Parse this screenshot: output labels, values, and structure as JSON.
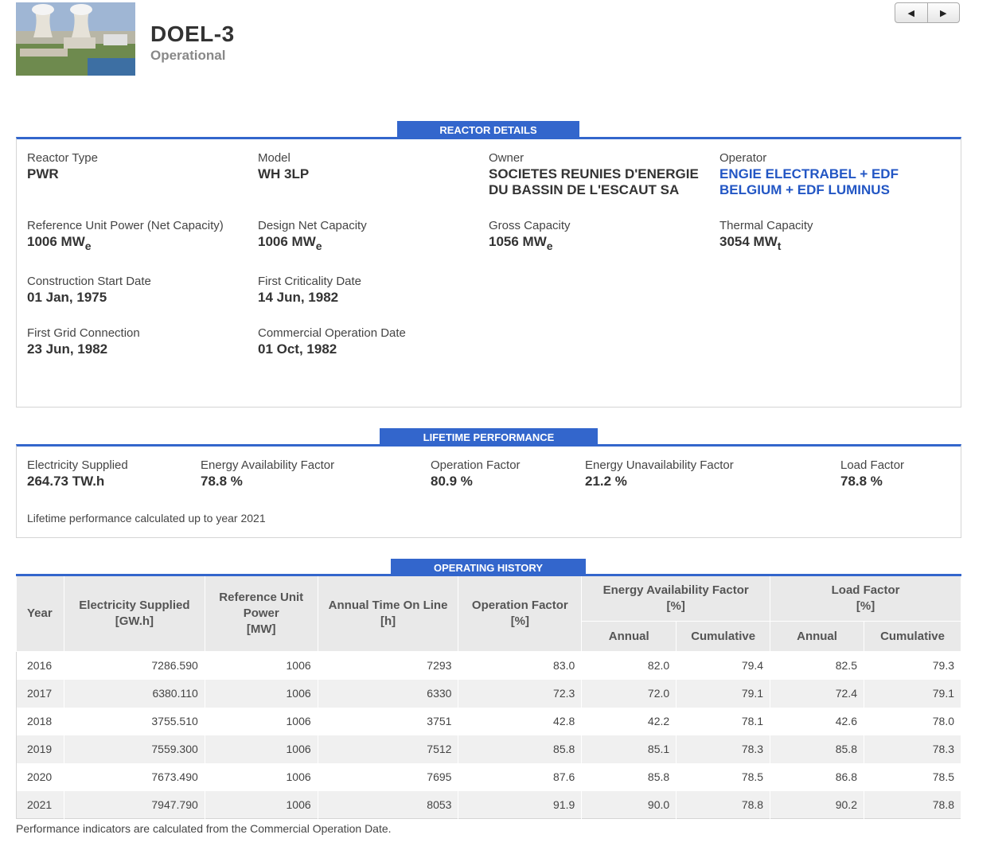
{
  "header": {
    "title": "DOEL-3",
    "status": "Operational",
    "photo_icon": "reactor-photo"
  },
  "pager": {
    "prev_icon": "◀",
    "next_icon": "▶"
  },
  "reactor_details": {
    "title": "REACTOR DETAILS",
    "reactor_type": {
      "label": "Reactor Type",
      "value": "PWR"
    },
    "model": {
      "label": "Model",
      "value": "WH 3LP"
    },
    "owner": {
      "label": "Owner",
      "value_line1": "SOCIETES REUNIES D'ENERGIE",
      "value_line2": "DU BASSIN DE L'ESCAUT SA"
    },
    "operator": {
      "label": "Operator",
      "value_line1": "ENGIE ELECTRABEL + EDF",
      "value_line2": "BELGIUM + EDF LUMINUS"
    },
    "reference_unit_power": {
      "label": "Reference Unit Power (Net Capacity)",
      "value": "1006 MW",
      "sub": "e"
    },
    "design_net_capacity": {
      "label": "Design Net Capacity",
      "value": "1006 MW",
      "sub": "e"
    },
    "gross_capacity": {
      "label": "Gross Capacity",
      "value": "1056 MW",
      "sub": "e"
    },
    "thermal_capacity": {
      "label": "Thermal Capacity",
      "value": "3054 MW",
      "sub": "t"
    },
    "construction_start": {
      "label": "Construction Start Date",
      "value": "01 Jan, 1975"
    },
    "first_criticality": {
      "label": "First Criticality Date",
      "value": "14 Jun, 1982"
    },
    "first_grid": {
      "label": "First Grid Connection",
      "value": "23 Jun, 1982"
    },
    "commercial_operation": {
      "label": "Commercial Operation Date",
      "value": "01 Oct, 1982"
    }
  },
  "lifetime": {
    "title": "LIFETIME PERFORMANCE",
    "electricity": {
      "label": "Electricity Supplied",
      "value": "264.73 TW.h"
    },
    "eaf": {
      "label": "Energy Availability Factor",
      "value": "78.8 %"
    },
    "operation_factor": {
      "label": "Operation Factor",
      "value": "80.9 %"
    },
    "euf": {
      "label": "Energy Unavailability Factor",
      "value": "21.2 %"
    },
    "load_factor": {
      "label": "Load Factor",
      "value": "78.8 %"
    },
    "note": "Lifetime performance calculated up to year 2021"
  },
  "history": {
    "title": "OPERATING HISTORY",
    "headers": {
      "year": "Year",
      "electricity_1": "Electricity Supplied",
      "electricity_2": "[GW.h]",
      "ref_1": "Reference Unit",
      "ref_2": "Power",
      "ref_3": "[MW]",
      "time_1": "Annual Time On Line",
      "time_2": "[h]",
      "op_1": "Operation Factor",
      "op_2": "[%]",
      "eaf_1": "Energy Availability Factor",
      "eaf_2": "[%]",
      "lf_1": "Load Factor",
      "lf_2": "[%]",
      "annual": "Annual",
      "cumulative": "Cumulative"
    },
    "rows": [
      {
        "year": "2016",
        "electricity": "7286.590",
        "ref": "1006",
        "time": "7293",
        "op": "83.0",
        "eaf_a": "82.0",
        "eaf_c": "79.4",
        "lf_a": "82.5",
        "lf_c": "79.3"
      },
      {
        "year": "2017",
        "electricity": "6380.110",
        "ref": "1006",
        "time": "6330",
        "op": "72.3",
        "eaf_a": "72.0",
        "eaf_c": "79.1",
        "lf_a": "72.4",
        "lf_c": "79.1"
      },
      {
        "year": "2018",
        "electricity": "3755.510",
        "ref": "1006",
        "time": "3751",
        "op": "42.8",
        "eaf_a": "42.2",
        "eaf_c": "78.1",
        "lf_a": "42.6",
        "lf_c": "78.0"
      },
      {
        "year": "2019",
        "electricity": "7559.300",
        "ref": "1006",
        "time": "7512",
        "op": "85.8",
        "eaf_a": "85.1",
        "eaf_c": "78.3",
        "lf_a": "85.8",
        "lf_c": "78.3"
      },
      {
        "year": "2020",
        "electricity": "7673.490",
        "ref": "1006",
        "time": "7695",
        "op": "87.6",
        "eaf_a": "85.8",
        "eaf_c": "78.5",
        "lf_a": "86.8",
        "lf_c": "78.5"
      },
      {
        "year": "2021",
        "electricity": "7947.790",
        "ref": "1006",
        "time": "8053",
        "op": "91.9",
        "eaf_a": "90.0",
        "eaf_c": "78.8",
        "lf_a": "90.2",
        "lf_c": "78.8"
      }
    ],
    "footnote": "Performance indicators are calculated from the Commercial Operation Date."
  },
  "colors": {
    "accent": "#3366cc",
    "link": "#2256c4",
    "header_bg": "#e9e9e9"
  }
}
